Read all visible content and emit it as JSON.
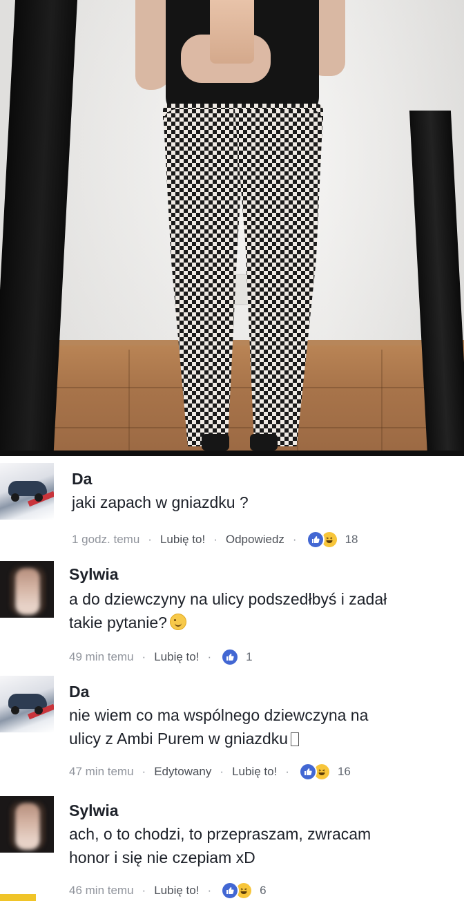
{
  "comments": [
    {
      "author": "Da",
      "text": "jaki zapach w gniazdku ?",
      "time": "1 godz. temu",
      "edited": "",
      "like_label": "Lubię to!",
      "reply_label": "Odpowiedz",
      "reactions": [
        "like",
        "haha"
      ],
      "reaction_count": "18"
    },
    {
      "author": "Sylwia",
      "text_line1": "a do dziewczyny na ulicy podszedłbyś i zadał",
      "text_line2": "takie pytanie?",
      "time": "49 min temu",
      "like_label": "Lubię to!",
      "reactions": [
        "like"
      ],
      "reaction_count": "1"
    },
    {
      "author": "Da",
      "text_line1": "nie wiem co ma wspólnego dziewczyna na",
      "text_line2": "ulicy z Ambi Purem w gniazdku",
      "time": "47 min temu",
      "edited": "Edytowany",
      "like_label": "Lubię to!",
      "reactions": [
        "like",
        "haha"
      ],
      "reaction_count": "16"
    },
    {
      "author": "Sylwia",
      "text_line1": "ach, o to chodzi, to przepraszam, zwracam",
      "text_line2": "honor i się nie czepiam xD",
      "time": "46 min temu",
      "like_label": "Lubię to!",
      "reactions": [
        "like",
        "haha"
      ],
      "reaction_count": "6"
    }
  ],
  "colors": {
    "text": "#1d2129",
    "meta": "#90949c",
    "like_blue": "#4267d3",
    "haha_yellow": "#f7c53a"
  },
  "icons": [
    "like-reaction-icon",
    "haha-reaction-icon",
    "wink-emoji-icon"
  ]
}
